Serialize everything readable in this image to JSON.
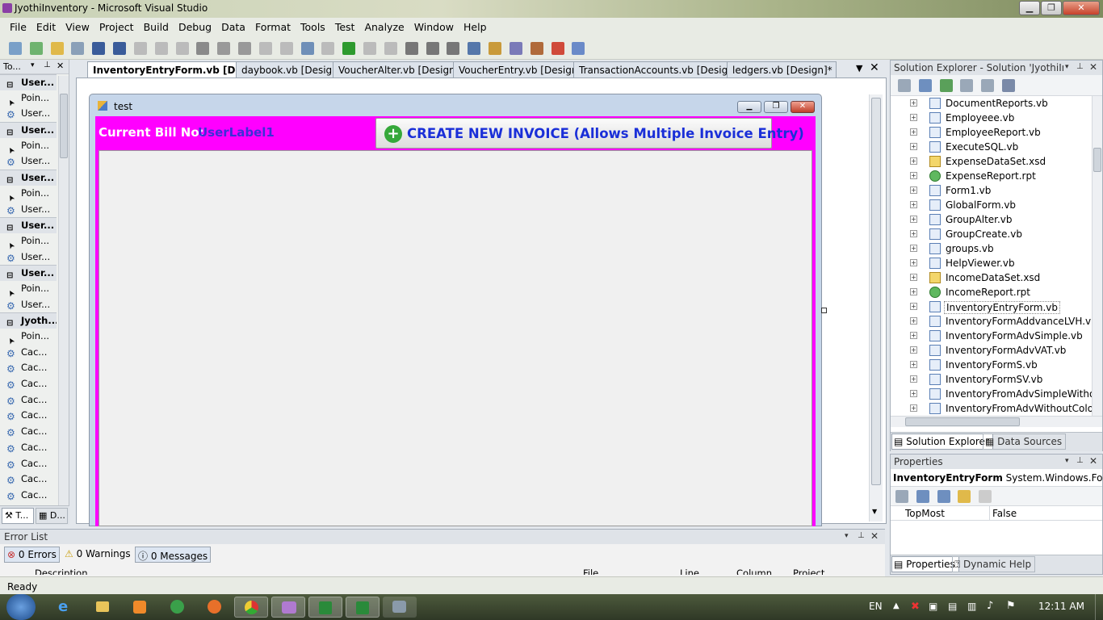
{
  "window": {
    "title": "JyothiInventory - Microsoft Visual Studio",
    "min": "▁",
    "max": "❐",
    "close": "✕"
  },
  "menu": [
    "File",
    "Edit",
    "View",
    "Project",
    "Build",
    "Debug",
    "Data",
    "Format",
    "Tools",
    "Test",
    "Analyze",
    "Window",
    "Help"
  ],
  "toolbox": {
    "title": "To...",
    "rows": [
      {
        "label": "User...",
        "type": "group"
      },
      {
        "label": "Poin...",
        "type": "pointer"
      },
      {
        "label": "User...",
        "type": "gear"
      },
      {
        "label": "User...",
        "type": "group"
      },
      {
        "label": "Poin...",
        "type": "pointer"
      },
      {
        "label": "User...",
        "type": "gear"
      },
      {
        "label": "User...",
        "type": "group"
      },
      {
        "label": "Poin...",
        "type": "pointer"
      },
      {
        "label": "User...",
        "type": "gear"
      },
      {
        "label": "User...",
        "type": "group"
      },
      {
        "label": "Poin...",
        "type": "pointer"
      },
      {
        "label": "User...",
        "type": "gear"
      },
      {
        "label": "User...",
        "type": "group"
      },
      {
        "label": "Poin...",
        "type": "pointer"
      },
      {
        "label": "User...",
        "type": "gear"
      },
      {
        "label": "Jyoth...",
        "type": "group"
      },
      {
        "label": "Poin...",
        "type": "pointer"
      },
      {
        "label": "Cac...",
        "type": "gear"
      },
      {
        "label": "Cac...",
        "type": "gear"
      },
      {
        "label": "Cac...",
        "type": "gear"
      },
      {
        "label": "Cac...",
        "type": "gear"
      },
      {
        "label": "Cac...",
        "type": "gear"
      },
      {
        "label": "Cac...",
        "type": "gear"
      },
      {
        "label": "Cac...",
        "type": "gear"
      },
      {
        "label": "Cac...",
        "type": "gear"
      },
      {
        "label": "Cac...",
        "type": "gear"
      },
      {
        "label": "Cac...",
        "type": "gear"
      }
    ],
    "bottom_tabs": [
      "T...",
      "D..."
    ]
  },
  "doc_tabs": [
    {
      "label": "InventoryEntryForm.vb [Design]",
      "active": true
    },
    {
      "label": "daybook.vb [Design]",
      "active": false
    },
    {
      "label": "VoucherAlter.vb [Design]",
      "active": false
    },
    {
      "label": "VoucherEntry.vb [Design]",
      "active": false
    },
    {
      "label": "TransactionAccounts.vb [Design]",
      "active": false
    },
    {
      "label": "ledgers.vb [Design]*",
      "active": false
    }
  ],
  "form": {
    "title": "test",
    "bill_label": "Current Bill No:",
    "bill_value": "UserLabel1",
    "create_button": "CREATE NEW INVOICE (Allows Multiple Invoice Entry)",
    "bg_color": "#ff00ff"
  },
  "solution_explorer": {
    "title": "Solution Explorer - Solution 'JyothiInv...",
    "items": [
      {
        "label": "DocumentReports.vb",
        "kind": "form"
      },
      {
        "label": "Employeee.vb",
        "kind": "form"
      },
      {
        "label": "EmployeeReport.vb",
        "kind": "form"
      },
      {
        "label": "ExecuteSQL.vb",
        "kind": "form"
      },
      {
        "label": "ExpenseDataSet.xsd",
        "kind": "xsd"
      },
      {
        "label": "ExpenseReport.rpt",
        "kind": "rpt"
      },
      {
        "label": "Form1.vb",
        "kind": "form"
      },
      {
        "label": "GlobalForm.vb",
        "kind": "form"
      },
      {
        "label": "GroupAlter.vb",
        "kind": "form"
      },
      {
        "label": "GroupCreate.vb",
        "kind": "form"
      },
      {
        "label": "groups.vb",
        "kind": "form"
      },
      {
        "label": "HelpViewer.vb",
        "kind": "form"
      },
      {
        "label": "IncomeDataSet.xsd",
        "kind": "xsd"
      },
      {
        "label": "IncomeReport.rpt",
        "kind": "rpt"
      },
      {
        "label": "InventoryEntryForm.vb",
        "kind": "form",
        "selected": true
      },
      {
        "label": "InventoryFormAddvanceLVH.vb",
        "kind": "form"
      },
      {
        "label": "InventoryFormAdvSimple.vb",
        "kind": "form"
      },
      {
        "label": "InventoryFormAdvVAT.vb",
        "kind": "form"
      },
      {
        "label": "InventoryFormS.vb",
        "kind": "form"
      },
      {
        "label": "InventoryFormSV.vb",
        "kind": "form"
      },
      {
        "label": "InventoryFromAdvSimpleWithout",
        "kind": "form"
      },
      {
        "label": "InventoryFromAdvWithoutColor.v",
        "kind": "form"
      }
    ],
    "tabs": [
      "Solution Explorer",
      "Data Sources"
    ]
  },
  "properties": {
    "title": "Properties",
    "object_name": "InventoryEntryForm",
    "object_type": "System.Windows.Forms",
    "row_name": "TopMost",
    "row_value": "False",
    "tabs": [
      "Properties",
      "Dynamic Help"
    ]
  },
  "error_list": {
    "title": "Error List",
    "errors": "0 Errors",
    "warnings": "0 Warnings",
    "messages": "0 Messages",
    "columns": [
      "Description",
      "File",
      "Line",
      "Column",
      "Project"
    ]
  },
  "status": "Ready",
  "taskbar": {
    "lang": "EN",
    "time": "12:11 AM"
  }
}
